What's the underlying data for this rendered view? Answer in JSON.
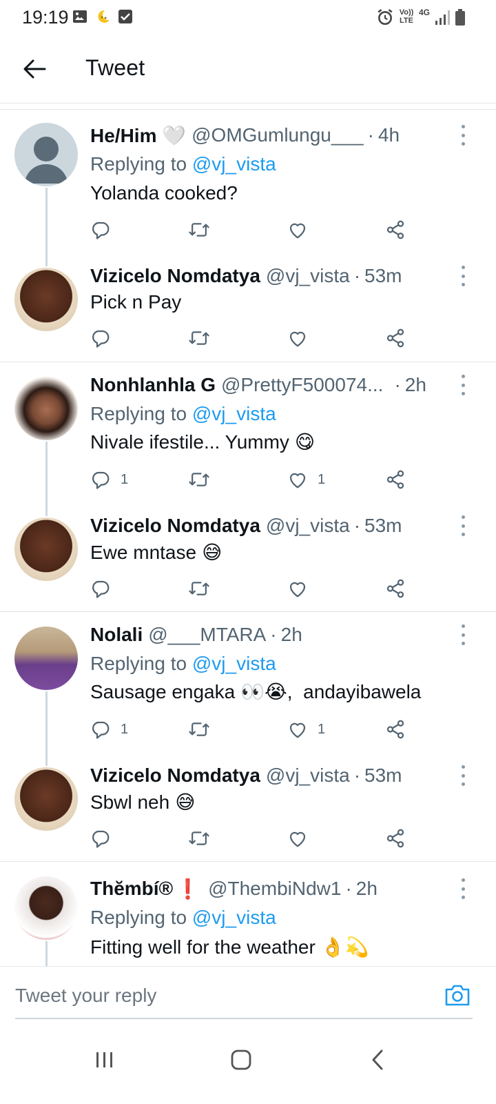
{
  "status_bar": {
    "time": "19:19",
    "network_label": "4G",
    "volte_label": "Vo)) LTE"
  },
  "app_bar": {
    "title": "Tweet"
  },
  "tweets": [
    {
      "name": "He/Him 🤍",
      "handle": "@OMGumlungu___",
      "time": "4h",
      "replying_prefix": "Replying to ",
      "replying_to": "@vj_vista",
      "text": "Yolanda cooked?",
      "reply_count": "",
      "like_count": ""
    },
    {
      "name": "Vizicelo Nomdatya",
      "handle": "@vj_vista",
      "time": "53m",
      "text": "Pick n Pay",
      "reply_count": "",
      "like_count": ""
    },
    {
      "name": "Nonhlanhla G",
      "handle": "@PrettyF500074...",
      "time": "2h",
      "replying_prefix": "Replying to ",
      "replying_to": "@vj_vista",
      "text": "Nivale ifestile... Yummy",
      "emoji": "😋",
      "reply_count": "1",
      "like_count": "1"
    },
    {
      "name": "Vizicelo Nomdatya",
      "handle": "@vj_vista",
      "time": "53m",
      "text": "Ewe mntase",
      "emoji": "😅",
      "reply_count": "",
      "like_count": ""
    },
    {
      "name": "Nolali",
      "handle": "@___MTARA",
      "time": "2h",
      "replying_prefix": "Replying to ",
      "replying_to": "@vj_vista",
      "text_a": "Sausage engaka",
      "emoji": "👀😭",
      "text_b": ",  andayibawela",
      "reply_count": "1",
      "like_count": "1"
    },
    {
      "name": "Vizicelo Nomdatya",
      "handle": "@vj_vista",
      "time": "53m",
      "text": "Sbwl neh",
      "emoji": "😅",
      "reply_count": "",
      "like_count": ""
    },
    {
      "name": "Thĕmbí®",
      "name_emoji": "❗",
      "handle": "@ThembiNdw1",
      "time": "2h",
      "replying_prefix": "Replying to ",
      "replying_to": "@vj_vista",
      "text": "Fitting well for the weather",
      "emoji": "👌💫"
    }
  ],
  "time_separator": "·",
  "reply_bar": {
    "placeholder": "Tweet your reply"
  },
  "colors": {
    "link_blue": "#1d9bf0",
    "secondary_text": "#536471",
    "icon_gray": "#536471",
    "thread_line": "#cfd9de"
  }
}
